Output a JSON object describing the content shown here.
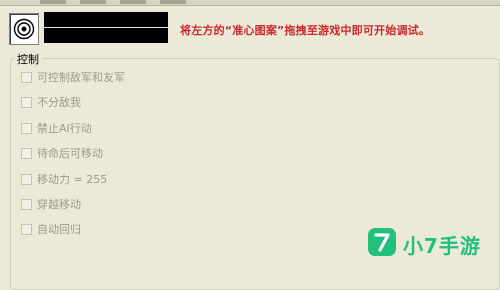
{
  "header": {
    "instruction": "将左方的“准心图案”拖拽至游戏中即可开始调试。"
  },
  "group": {
    "title": "控制",
    "options": [
      {
        "label": "可控制敌军和友军",
        "checked": false
      },
      {
        "label": "不分敌我",
        "checked": false
      },
      {
        "label": "禁止AI行动",
        "checked": false
      },
      {
        "label": "待命后可移动",
        "checked": false
      },
      {
        "label": "移动力 = 255",
        "checked": false
      },
      {
        "label": "穿越移动",
        "checked": false
      },
      {
        "label": "自动回归",
        "checked": false
      }
    ]
  },
  "watermark": {
    "logo_glyph": "7",
    "text": "小7手游",
    "color": "#21c07d"
  },
  "icons": {
    "target": "crosshair-target-icon"
  }
}
